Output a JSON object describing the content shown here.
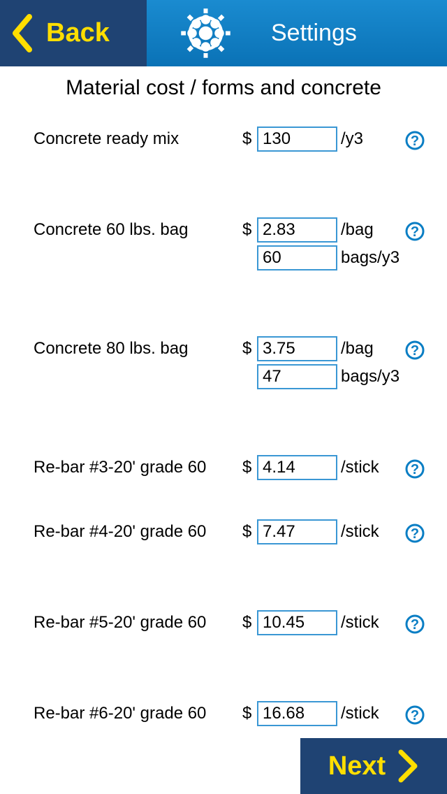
{
  "header": {
    "back_label": "Back",
    "title": "Settings"
  },
  "subtitle": "Material cost / forms and concrete",
  "rows": [
    {
      "label": "Concrete ready mix",
      "currency": "$",
      "value1": "130",
      "unit1": "/y3"
    },
    {
      "label": "Concrete 60 lbs. bag",
      "currency": "$",
      "value1": "2.83",
      "unit1": "/bag",
      "value2": "60",
      "unit2": "bags/y3"
    },
    {
      "label": "Concrete 80 lbs. bag",
      "currency": "$",
      "value1": "3.75",
      "unit1": "/bag",
      "value2": "47",
      "unit2": "bags/y3"
    },
    {
      "label": "Re-bar #3-20' grade 60",
      "currency": "$",
      "value1": "4.14",
      "unit1": "/stick"
    },
    {
      "label": "Re-bar #4-20' grade 60",
      "currency": "$",
      "value1": "7.47",
      "unit1": "/stick"
    },
    {
      "label": "Re-bar #5-20' grade 60",
      "currency": "$",
      "value1": "10.45",
      "unit1": "/stick"
    },
    {
      "label": "Re-bar #6-20' grade 60",
      "currency": "$",
      "value1": "16.68",
      "unit1": "/stick"
    }
  ],
  "footer": {
    "next_label": "Next"
  }
}
